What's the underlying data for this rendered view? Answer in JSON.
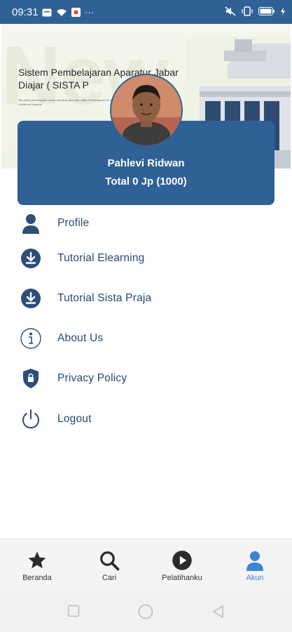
{
  "status_bar": {
    "time": "09:31",
    "more": "···"
  },
  "banner": {
    "watermark": "New",
    "title": "Sistem Pembelajaran Aparatur Jabar Diajar ( SISTA P",
    "subtitle": "Tak terbit pembelajaran online dari jarak jauh dan untuk Pembelajaran 20 JP perladen Lanatir av Tanntrari"
  },
  "profile": {
    "name": "Pahlevi Ridwan",
    "total": "Total 0 Jp (1000)"
  },
  "menu": {
    "items": [
      {
        "label": "Profile",
        "icon": "person-icon"
      },
      {
        "label": "Tutorial Elearning",
        "icon": "download-icon"
      },
      {
        "label": "Tutorial Sista Praja",
        "icon": "download-icon"
      },
      {
        "label": "About Us",
        "icon": "info-icon"
      },
      {
        "label": "Privacy Policy",
        "icon": "shield-lock-icon"
      },
      {
        "label": "Logout",
        "icon": "power-icon"
      }
    ]
  },
  "bottom_nav": {
    "items": [
      {
        "label": "Beranda",
        "icon": "star-icon",
        "active": false
      },
      {
        "label": "Cari",
        "icon": "search-icon",
        "active": false
      },
      {
        "label": "Pelatihanku",
        "icon": "play-icon",
        "active": false
      },
      {
        "label": "Akun",
        "icon": "person-icon",
        "active": true
      }
    ]
  },
  "colors": {
    "primary": "#2f6196",
    "menu_text": "#274a70",
    "active_nav": "#3a86d8"
  }
}
